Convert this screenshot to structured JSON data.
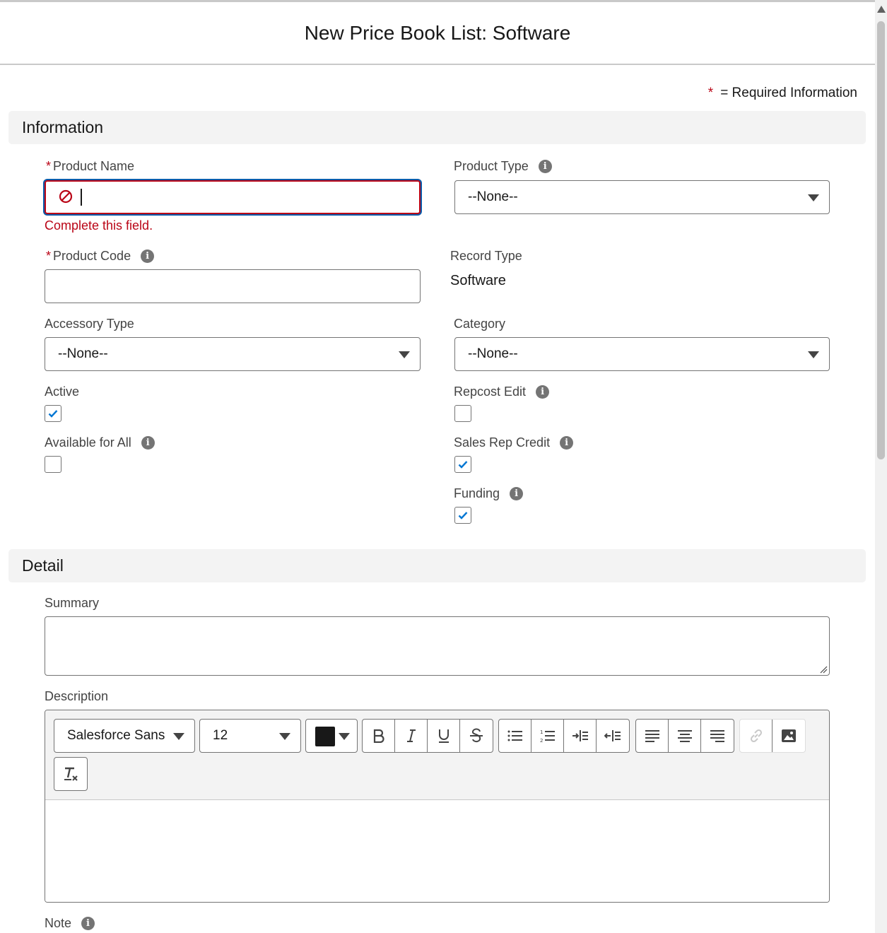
{
  "modal": {
    "title": "New Price Book List: Software"
  },
  "legend": {
    "star": "*",
    "text": "= Required Information"
  },
  "sections": {
    "information": "Information",
    "detail": "Detail"
  },
  "fields": {
    "product_name": {
      "required": "*",
      "label": "Product Name",
      "value": "",
      "error": "Complete this field."
    },
    "product_type": {
      "label": "Product Type",
      "value": "--None--"
    },
    "product_code": {
      "required": "*",
      "label": "Product Code",
      "value": ""
    },
    "record_type": {
      "label": "Record Type",
      "value": "Software"
    },
    "accessory_type": {
      "label": "Accessory Type",
      "value": "--None--"
    },
    "category": {
      "label": "Category",
      "value": "--None--"
    },
    "active": {
      "label": "Active",
      "checked": true
    },
    "repcost_edit": {
      "label": "Repcost Edit",
      "checked": false
    },
    "available_for_all": {
      "label": "Available for All",
      "checked": false
    },
    "sales_rep_credit": {
      "label": "Sales Rep Credit",
      "checked": true
    },
    "funding": {
      "label": "Funding",
      "checked": true
    },
    "summary": {
      "label": "Summary",
      "value": ""
    },
    "description": {
      "label": "Description",
      "value": ""
    },
    "note": {
      "label": "Note"
    }
  },
  "editor": {
    "font_family": "Salesforce Sans",
    "font_size": "12",
    "text_color": "#181818",
    "buttons": [
      "bold",
      "italic",
      "underline",
      "strikethrough",
      "bulleted-list",
      "numbered-list",
      "indent",
      "outdent",
      "align-left",
      "align-center",
      "align-right",
      "link",
      "image",
      "remove-formatting"
    ]
  },
  "colors": {
    "error": "#ba0517",
    "focus": "#0b5cab",
    "check": "#0176d3",
    "section_bg": "#f3f3f3"
  }
}
